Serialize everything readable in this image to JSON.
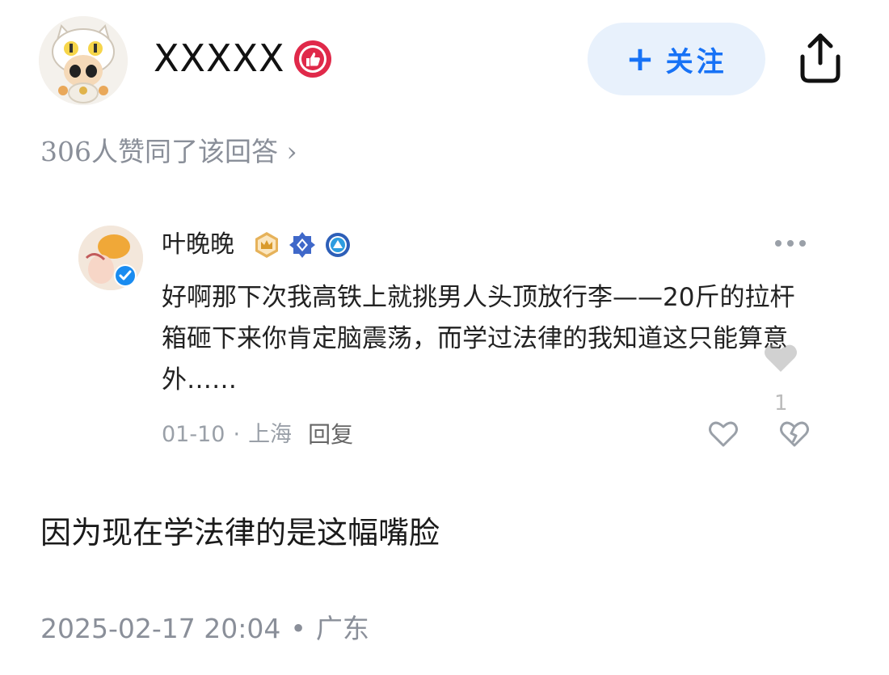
{
  "author": {
    "name": "XXXXX",
    "follow_label": "关注",
    "follow_plus": "+"
  },
  "agree": {
    "text": "306人赞同了该回答 ›"
  },
  "comment": {
    "user": "叶晚晚",
    "body": "好啊那下次我高铁上就挑男人头顶放行李——20斤的拉杆箱砸下来你肯定脑震荡，而学过法律的我知道这只能算意外……",
    "overlay_count": "1",
    "date": "01-10",
    "sep": "·",
    "location": "上海",
    "reply_label": "回复"
  },
  "answer": {
    "text": "因为现在学法律的是这幅嘴脸"
  },
  "footer": {
    "datetime": "2025-02-17 20:04",
    "sep": "•",
    "location": "广东"
  },
  "colors": {
    "accent": "#1772f6",
    "follow_bg": "#e8f1fc",
    "muted": "#8a8f99",
    "badge_red": "#e0294a"
  }
}
